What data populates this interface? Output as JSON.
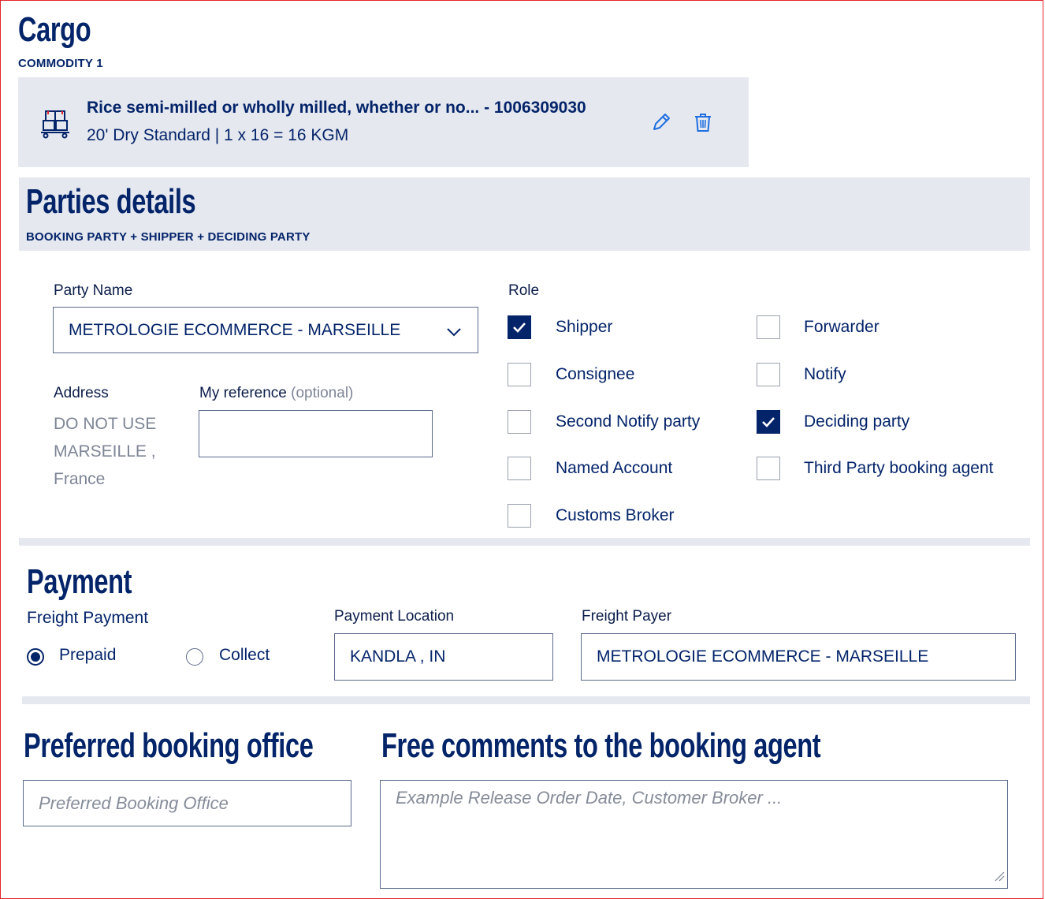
{
  "cargo": {
    "title": "Cargo",
    "commodity_label": "COMMODITY 1",
    "commodity": {
      "description": "Rice semi-milled or wholly milled, whether or no... - 1006309030",
      "details": "20' Dry Standard | 1 x 16 = 16 KGM",
      "icon": "cargo-boxes-icon",
      "edit_icon": "pencil-icon",
      "delete_icon": "trash-icon"
    }
  },
  "parties": {
    "title": "Parties details",
    "subtitle": "BOOKING PARTY + SHIPPER + DECIDING PARTY",
    "party_name_label": "Party Name",
    "party_name_value": "METROLOGIE ECOMMERCE - MARSEILLE",
    "address_label": "Address",
    "address_lines": [
      "DO NOT USE",
      "MARSEILLE ,",
      "France"
    ],
    "reference_label": "My reference",
    "reference_optional": "(optional)",
    "reference_value": "",
    "role_label": "Role",
    "roles": [
      {
        "label": "Shipper",
        "checked": true
      },
      {
        "label": "Forwarder",
        "checked": false
      },
      {
        "label": "Consignee",
        "checked": false
      },
      {
        "label": "Notify",
        "checked": false
      },
      {
        "label": "Second Notify party",
        "checked": false
      },
      {
        "label": "Deciding party",
        "checked": true
      },
      {
        "label": "Named Account",
        "checked": false
      },
      {
        "label": "Third Party booking agent",
        "checked": false
      },
      {
        "label": "Customs Broker",
        "checked": false
      }
    ]
  },
  "payment": {
    "title": "Payment",
    "freight_payment_label": "Freight Payment",
    "options": [
      {
        "label": "Prepaid",
        "selected": true
      },
      {
        "label": "Collect",
        "selected": false
      }
    ],
    "location_label": "Payment Location",
    "location_value": "KANDLA , IN",
    "payer_label": "Freight Payer",
    "payer_value": "METROLOGIE ECOMMERCE - MARSEILLE"
  },
  "booking_office": {
    "title": "Preferred booking office",
    "placeholder": "Preferred Booking Office"
  },
  "comments": {
    "title": "Free comments to the booking agent",
    "placeholder": "Example Release Order Date, Customer Broker ..."
  },
  "colors": {
    "navy": "#04246a",
    "band": "#e5e8ef",
    "accent_blue": "#1f6fe0",
    "frame_red": "#e5252a"
  }
}
